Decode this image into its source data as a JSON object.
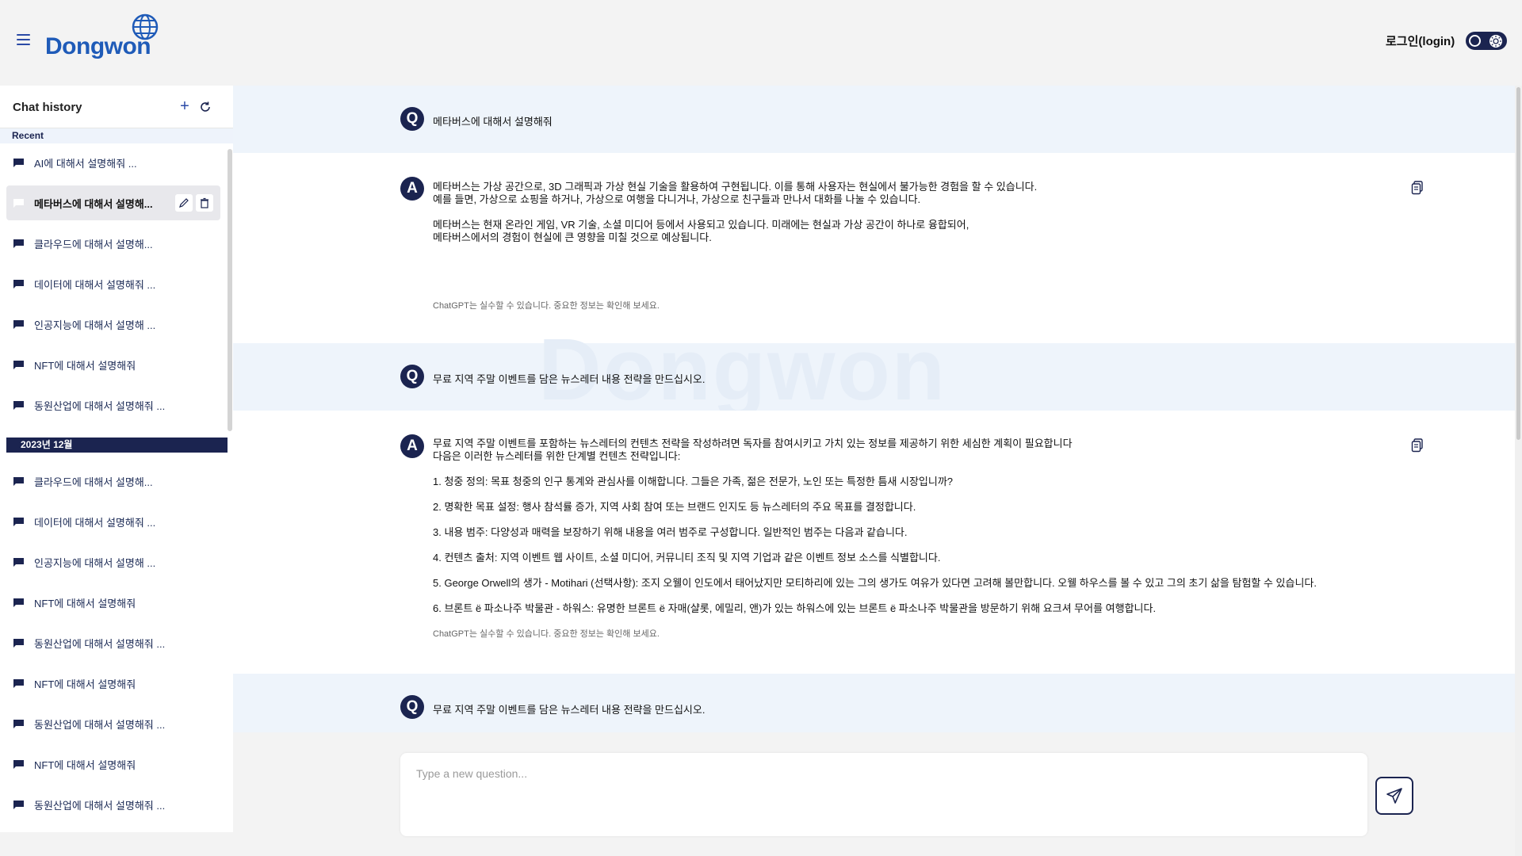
{
  "header": {
    "logo_text": "Dongwon",
    "login_label": "로그인(login)",
    "menu_icon": "hamburger-icon",
    "theme_toggle_icon": "sun-icon"
  },
  "sidebar": {
    "title": "Chat history",
    "add_icon": "+",
    "recent_label": "Recent",
    "recent_items": [
      {
        "label": "AI에 대해서 설명해줘 ..."
      },
      {
        "label": "메타버스에 대해서 설명해..."
      },
      {
        "label": "클라우드에 대해서 설명해..."
      },
      {
        "label": "데이터에 대해서 설명해줘 ..."
      },
      {
        "label": "인공지능에 대해서 설명해 ..."
      },
      {
        "label": "NFT에 대해서 설명해줘"
      },
      {
        "label": "동원산업에 대해서 설명해줘 ..."
      }
    ],
    "month_label": "2023년 12월",
    "month_items": [
      {
        "label": "클라우드에 대해서 설명해..."
      },
      {
        "label": "데이터에 대해서 설명해줘 ..."
      },
      {
        "label": "인공지능에 대해서 설명해 ..."
      },
      {
        "label": "NFT에 대해서 설명해줘"
      },
      {
        "label": "동원산업에 대해서 설명해줘 ..."
      },
      {
        "label": "NFT에 대해서 설명해줘"
      },
      {
        "label": "동원산업에 대해서 설명해줘 ..."
      },
      {
        "label": "NFT에 대해서 설명해줘"
      },
      {
        "label": "동원산업에 대해서 설명해줘 ..."
      }
    ]
  },
  "conversation": {
    "q_badge": "Q",
    "a_badge": "A",
    "q1": "메타버스에 대해서 설명해줘",
    "a1": {
      "lines": [
        "메타버스는 가상 공간으로, 3D 그래픽과 가상 현실 기술을 활용하여 구현됩니다. 이를 통해 사용자는 현실에서 불가능한 경험을 할 수 있습니다.",
        "예를 들면, 가상으로 쇼핑을 하거나, 가상으로 여행을 다니거나, 가상으로 친구들과 만나서 대화를 나눌 수 있습니다.",
        "메타버스는 현재 온라인 게임, VR 기술, 소셜 미디어 등에서 사용되고 있습니다. 미래에는 현실과 가상 공간이 하나로 융합되어,",
        "메타버스에서의 경험이 현실에 큰 영향을 미칠 것으로 예상됩니다."
      ],
      "disclaimer": "ChatGPT는 실수할 수 있습니다. 중요한 정보는 확인해 보세요."
    },
    "q2": "무료 지역 주말 이벤트를 담은 뉴스레터 내용 전략을 만드십시오.",
    "a2": {
      "intro1": "무료 지역 주말 이벤트를 포함하는 뉴스레터의 컨텐츠 전략을 작성하려면 독자를 참여시키고 가치 있는 정보를 제공하기 위한 세심한 계획이 필요합니다",
      "intro2": "다음은 이러한 뉴스레터를 위한 단계별 컨텐츠 전략입니다:",
      "steps": [
        "1. 청중 정의: 목표 청중의 인구 통계와 관심사를 이해합니다. 그들은 가족, 젊은 전문가, 노인 또는 특정한 틈새 시장입니까?",
        "2. 명확한 목표 설정: 행사 참석률 증가, 지역 사회 참여 또는 브랜드 인지도 등 뉴스레터의 주요 목표를 결정합니다.",
        "3. 내용 범주: 다양성과 매력을 보장하기 위해 내용을 여러 범주로 구성합니다. 일반적인 범주는 다음과 같습니다.",
        "4. 컨텐츠 출처: 지역 이벤트 웹 사이트, 소셜 미디어, 커뮤니티 조직 및 지역 기업과 같은 이벤트 정보 소스를 식별합니다.",
        "5. George Orwell의 생가 - Motihari (선택사항): 조지 오웰이 인도에서 태어났지만 모티하리에 있는 그의 생가도 여유가 있다면 고려해 볼만합니다. 오웰 하우스를 볼 수 있고 그의 초기 삶을 탐험할 수 있습니다.",
        "6. 브론트 ë 파소나주 박물관 - 하워스: 유명한 브론트 ë 자매(샬롯, 에밀리, 앤)가 있는 하워스에 있는 브론트 ë 파소나주 박물관을 방문하기 위해 요크셔 무어를 여행합니다."
      ],
      "disclaimer": "ChatGPT는 실수할 수 있습니다. 중요한 정보는 확인해 보세요."
    },
    "q3": "무료 지역 주말 이벤트를 담은 뉴스레터 내용 전략을 만드십시오.",
    "watermark": "Dongwon"
  },
  "composer": {
    "placeholder": "Type a new question..."
  },
  "colors": {
    "navy": "#1b2450",
    "brand_blue": "#1f5bb8",
    "question_band": "#eef4fb",
    "header_bg": "#f3f3f3"
  }
}
